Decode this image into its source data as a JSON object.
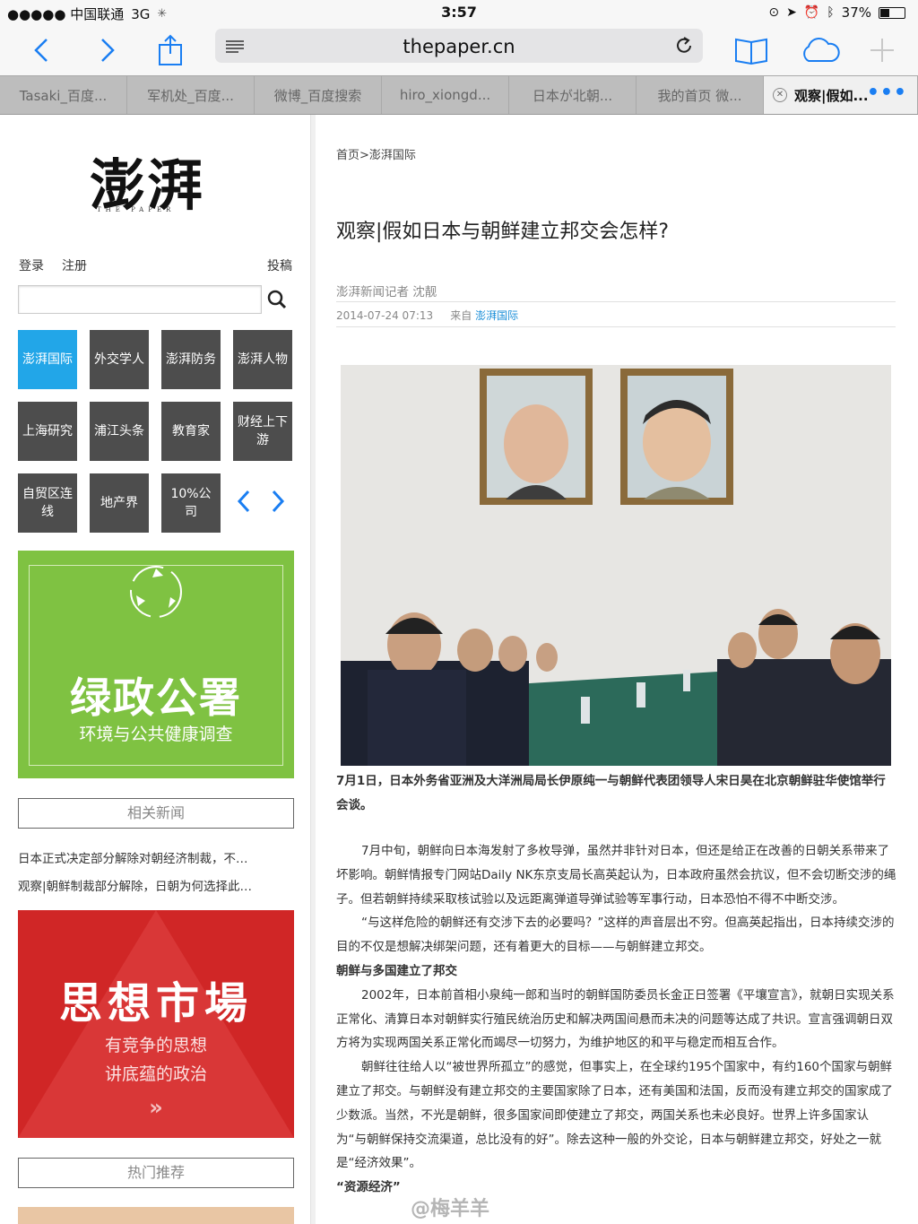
{
  "status_bar": {
    "carrier": "●●●●● 中国联通",
    "network": "3G",
    "time": "3:57",
    "battery": "37%",
    "battery_level": 0.37
  },
  "browser": {
    "url": "thepaper.cn",
    "tabs": [
      {
        "label": "Tasaki_百度..."
      },
      {
        "label": "军机处_百度..."
      },
      {
        "label": "微博_百度搜索"
      },
      {
        "label": "hiro_xiongd..."
      },
      {
        "label": "日本が北朝..."
      },
      {
        "label": "我的首页 微..."
      },
      {
        "label": "观察|假如..."
      }
    ],
    "more": "•••"
  },
  "sidebar": {
    "logo": "澎湃",
    "logo_en": "THE PAPER",
    "login": "登录",
    "register": "注册",
    "submit": "投稿",
    "search_placeholder": "",
    "categories": [
      {
        "label": "澎湃国际"
      },
      {
        "label": "外交学人"
      },
      {
        "label": "澎湃防务"
      },
      {
        "label": "澎湃人物"
      },
      {
        "label": "上海研究"
      },
      {
        "label": "浦江头条"
      },
      {
        "label": "教育家"
      },
      {
        "label": "财经上下游"
      },
      {
        "label": "自贸区连线"
      },
      {
        "label": "地产界"
      },
      {
        "label": "10%公司"
      }
    ],
    "ad_green": {
      "title": "绿政公署",
      "subtitle": "环境与公共健康调查"
    },
    "related_title": "相关新闻",
    "related": [
      "日本正式决定部分解除对朝经济制裁，不…",
      "观察|朝鲜制裁部分解除，日朝为何选择此…"
    ],
    "ad_red": {
      "title": "思想市場",
      "line1": "有竞争的思想",
      "line2": "讲底蕴的政治",
      "more": "»"
    },
    "hot_title": "热门推荐"
  },
  "article": {
    "breadcrumb": "首页>澎湃国际",
    "title": "观察|假如日本与朝鲜建立邦交会怎样?",
    "author": "澎湃新闻记者 沈靓",
    "date": "2014-07-24 07:13",
    "source_label": "来自",
    "source": "澎湃国际",
    "caption": "7月1日，日本外务省亚洲及大洋洲局局长伊原纯一与朝鲜代表团领导人宋日昊在北京朝鲜驻华使馆举行会谈。",
    "p1": "7月中旬，朝鲜向日本海发射了多枚导弹，虽然并非针对日本，但还是给正在改善的日朝关系带来了坏影响。朝鲜情报专门网站Daily NK东京支局长高英起认为，日本政府虽然会抗议，但不会切断交涉的绳子。但若朝鲜持续采取核试验以及远距离弹道导弹试验等军事行动，日本恐怕不得不中断交涉。",
    "p2": "“与这样危险的朝鲜还有交涉下去的必要吗？”这样的声音层出不穷。但高英起指出，日本持续交涉的目的不仅是想解决绑架问题，还有着更大的目标——与朝鲜建立邦交。",
    "h1": "朝鲜与多国建立了邦交",
    "p3": "2002年，日本前首相小泉纯一郎和当时的朝鲜国防委员长金正日签署《平壤宣言》，就朝日实现关系正常化、清算日本对朝鲜实行殖民统治历史和解决两国间悬而未决的问题等达成了共识。宣言强调朝日双方将为实现两国关系正常化而竭尽一切努力，为维护地区的和平与稳定而相互合作。",
    "p4": "朝鲜往往给人以“被世界所孤立”的感觉，但事实上，在全球约195个国家中，有约160个国家与朝鲜建立了邦交。与朝鲜没有建立邦交的主要国家除了日本，还有美国和法国，反而没有建立邦交的国家成了少数派。当然，不光是朝鲜，很多国家间即使建立了邦交，两国关系也未必良好。世界上许多国家认为“与朝鲜保持交流渠道，总比没有的好”。除去这种一般的外交论，日本与朝鲜建立邦交，好处之一就是“经济效果”。",
    "h2": "“资源经济”",
    "watermark": "@梅羊羊"
  },
  "colors": {
    "accent": "#1a7ef2",
    "category_active": "#22a6e8",
    "category": "#4d4d4d",
    "ad_green": "#7fc242",
    "ad_red": "#d02626"
  }
}
